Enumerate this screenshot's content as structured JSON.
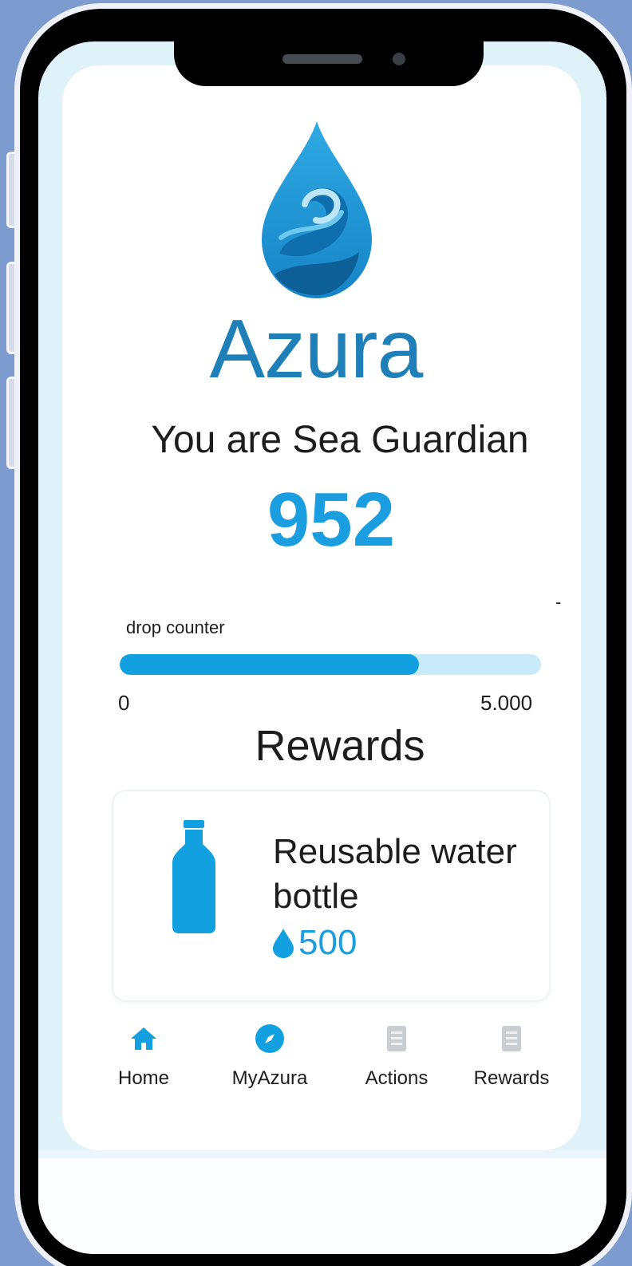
{
  "app": {
    "name": "Azura",
    "logo_icon": "water-drop-wave-logo",
    "accent_color": "#1b9ee0",
    "brand_color": "#1f7fb8"
  },
  "status": {
    "rank_text": "You are Sea Guardian",
    "score": "952"
  },
  "progress": {
    "dash": "-",
    "label": "drop counter",
    "min_label": "0",
    "max_label": "5.000",
    "fill_fraction": 0.71
  },
  "rewards": {
    "title": "Rewards",
    "items": [
      {
        "icon": "water-bottle-icon",
        "name": "Reusable water bottle",
        "cost_icon": "drop-icon",
        "cost": "500"
      }
    ]
  },
  "nav": {
    "items": [
      {
        "label": "Home",
        "icon": "home-icon",
        "active": true
      },
      {
        "label": "MyAzura",
        "icon": "compass-icon",
        "active": true
      },
      {
        "label": "Actions",
        "icon": "document-icon",
        "active": false
      },
      {
        "label": "Rewards",
        "icon": "document-icon",
        "active": false
      }
    ]
  }
}
